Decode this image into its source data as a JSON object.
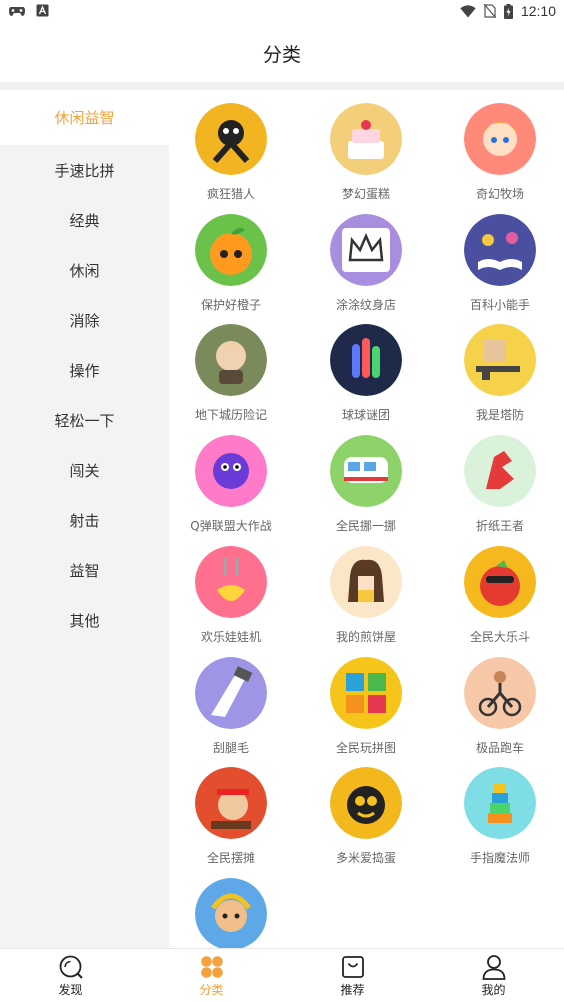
{
  "status_bar": {
    "time": "12:10",
    "icons": [
      "game-controller-icon",
      "a-box-icon",
      "wifi-icon",
      "no-sim-icon",
      "battery-charging-icon"
    ]
  },
  "header": {
    "title": "分类"
  },
  "sidebar": {
    "items": [
      {
        "label": "休闲益智",
        "active": true
      },
      {
        "label": "手速比拼"
      },
      {
        "label": "经典"
      },
      {
        "label": "休闲"
      },
      {
        "label": "消除"
      },
      {
        "label": "操作"
      },
      {
        "label": "轻松一下"
      },
      {
        "label": "闯关"
      },
      {
        "label": "射击"
      },
      {
        "label": "益智"
      },
      {
        "label": "其他"
      }
    ]
  },
  "games": [
    {
      "name": "疯狂猎人",
      "icon": "stickman-hunter-icon",
      "color": "#f2b420"
    },
    {
      "name": "梦幻蛋糕",
      "icon": "cake-icon",
      "color": "#f4cf7a"
    },
    {
      "name": "奇幻牧场",
      "icon": "ranch-girl-icon",
      "color": "#ff8a7a"
    },
    {
      "name": "保护好橙子",
      "icon": "orange-icon",
      "color": "#6bc24a"
    },
    {
      "name": "涂涂纹身店",
      "icon": "crown-tattoo-icon",
      "color": "#a98ee0"
    },
    {
      "name": "百科小能手",
      "icon": "encyclopedia-book-icon",
      "color": "#4b4f9f"
    },
    {
      "name": "地下城历险记",
      "icon": "dungeon-hero-icon",
      "color": "#7a8a5a"
    },
    {
      "name": "球球谜团",
      "icon": "ball-tubes-icon",
      "color": "#1f2a4a"
    },
    {
      "name": "我是塔防",
      "icon": "tower-defense-gun-icon",
      "color": "#f5d24a"
    },
    {
      "name": "Q弹联盟大作战",
      "icon": "purple-blob-icon",
      "color": "#ff7ac8"
    },
    {
      "name": "全民挪一挪",
      "icon": "train-icon",
      "color": "#8ed36a"
    },
    {
      "name": "折纸王者",
      "icon": "origami-rooster-icon",
      "color": "#d9f2d9"
    },
    {
      "name": "欢乐娃娃机",
      "icon": "claw-machine-icon",
      "color": "#ff6f8e"
    },
    {
      "name": "我的煎饼屋",
      "icon": "pancake-girl-icon",
      "color": "#fbe6c7"
    },
    {
      "name": "全民大乐斗",
      "icon": "angry-tomato-icon",
      "color": "#f5b91e"
    },
    {
      "name": "刮腿毛",
      "icon": "shaving-leg-icon",
      "color": "#9f95e6"
    },
    {
      "name": "全民玩拼图",
      "icon": "puzzle-icon",
      "color": "#f6c51a"
    },
    {
      "name": "极品跑车",
      "icon": "bike-rider-icon",
      "color": "#f6c8a8"
    },
    {
      "name": "全民摆摊",
      "icon": "street-vendor-icon",
      "color": "#e24e2e"
    },
    {
      "name": "多米爱捣蛋",
      "icon": "bomb-face-icon",
      "color": "#f2b81c"
    },
    {
      "name": "手指魔法师",
      "icon": "stacking-blocks-icon",
      "color": "#7fdde6"
    },
    {
      "name": "",
      "icon": "monkey-king-icon",
      "color": "#5fa8e8"
    }
  ],
  "tabs": [
    {
      "label": "发现",
      "icon": "discover-icon"
    },
    {
      "label": "分类",
      "icon": "category-icon",
      "active": true
    },
    {
      "label": "推荐",
      "icon": "recommend-bag-icon"
    },
    {
      "label": "我的",
      "icon": "profile-icon"
    }
  ],
  "colors": {
    "accent": "#f3a23c",
    "sidebar_bg": "#f3f3f3"
  }
}
